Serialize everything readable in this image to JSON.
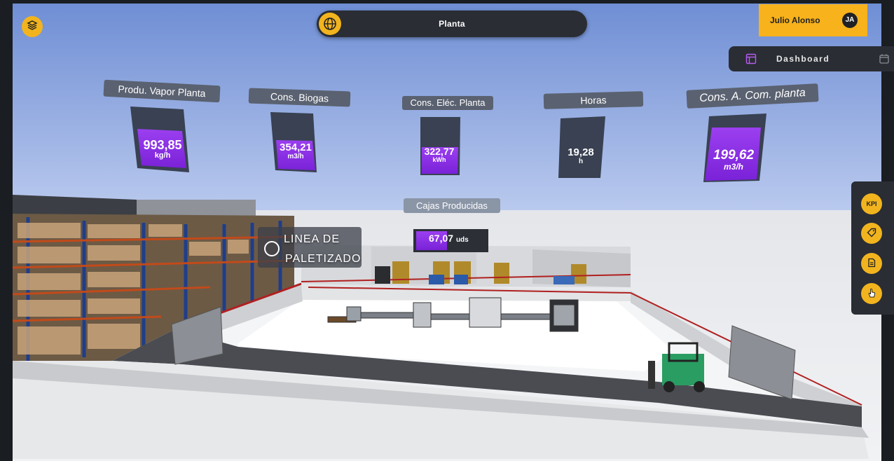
{
  "header": {
    "location_label": "Planta",
    "user_name": "Julio Alonso",
    "user_initials": "JA",
    "dashboard_label": "Dashboard"
  },
  "kpis": [
    {
      "title": "Produ. Vapor Planta",
      "value": "993,85",
      "unit": "kg/h"
    },
    {
      "title": "Cons. Biogas",
      "value": "354,21",
      "unit": "m3/h"
    },
    {
      "title": "Cons. Eléc. Planta",
      "value": "322,77",
      "unit": "kWh"
    },
    {
      "title": "Horas",
      "value": "19,28",
      "unit": "h"
    },
    {
      "title": "Cons. A. Com. planta",
      "value": "199,62",
      "unit": "m3/h"
    }
  ],
  "boxes": {
    "title": "Cajas Producidas",
    "value": "67,07",
    "unit": "uds"
  },
  "line_label": {
    "line1": "LINEA DE",
    "line2": "PALETIZADO"
  },
  "side_menu": {
    "kpi_label": "KPI"
  },
  "icons": [
    "layers-icon",
    "globe-icon",
    "dashboard-icon",
    "calendar-icon",
    "tag-icon",
    "document-icon",
    "hand-pointer-icon"
  ],
  "colors": {
    "accent": "#f2b41e",
    "kpi_fill": "#8a2be2",
    "panel": "#2a2d34"
  }
}
